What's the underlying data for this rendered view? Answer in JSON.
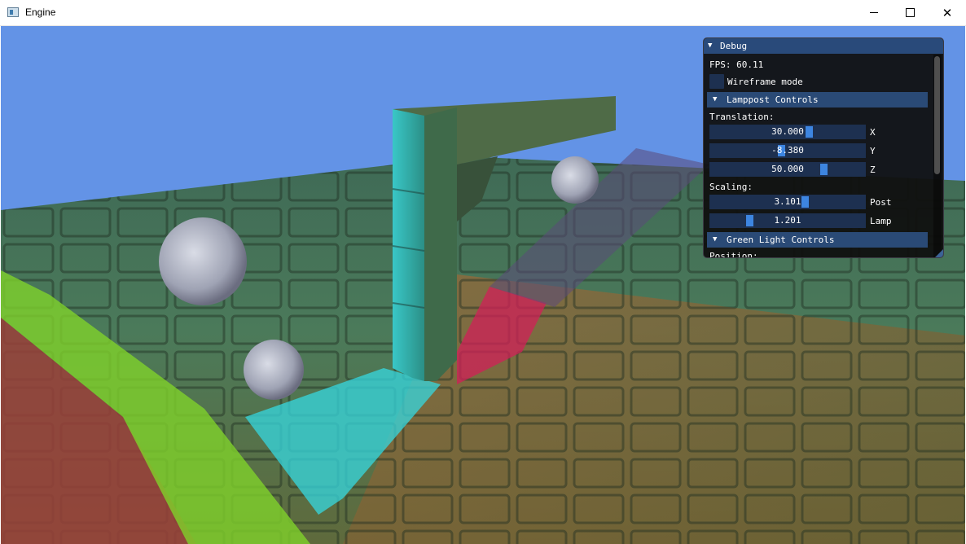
{
  "window": {
    "title": "Engine",
    "icon": "app-window-icon",
    "controls": [
      "minimize-icon",
      "maximize-icon",
      "close-icon"
    ],
    "close_glyph": "✕"
  },
  "scene": {
    "sky_color": "#6393e6",
    "objects": [
      "stone-floor",
      "lamppost",
      "cyan-spotlight",
      "red-spotlight",
      "green-spotlight",
      "stone-sphere"
    ]
  },
  "debug": {
    "title": "Debug",
    "arrow": "▼",
    "fps_text": "FPS: 60.11",
    "wireframe_label": "Wireframe mode",
    "wireframe_checked": false,
    "lamppost": {
      "header": "Lamppost Controls",
      "translation_label": "Translation:",
      "x": {
        "value": "30.000",
        "label": "X"
      },
      "y": {
        "value": "-8.380",
        "label": "Y"
      },
      "z": {
        "value": "50.000",
        "label": "Z"
      },
      "scaling_label": "Scaling:",
      "post": {
        "value": "3.101",
        "label": "Post"
      },
      "lamp": {
        "value": "1.201",
        "label": "Lamp"
      }
    },
    "green_light": {
      "header": "Green Light Controls",
      "position_label": "Position:"
    },
    "accent_color": "#3d85e0"
  }
}
